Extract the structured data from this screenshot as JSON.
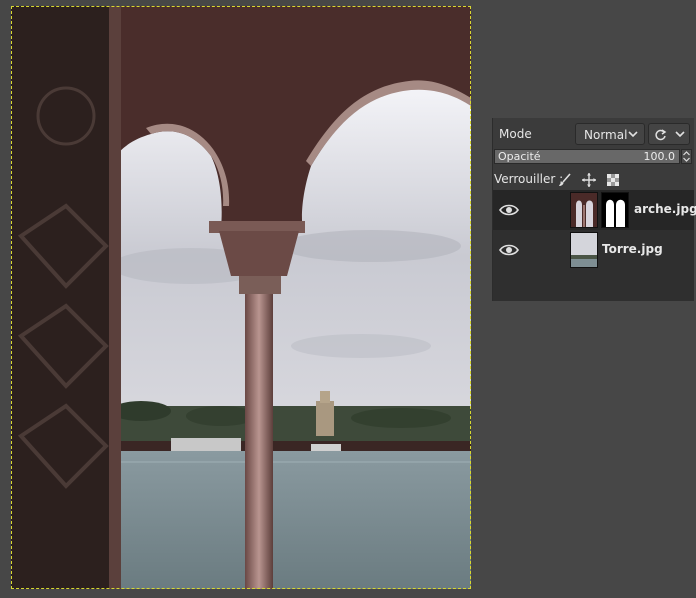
{
  "layers_panel": {
    "mode_label": "Mode",
    "mode_value": "Normal",
    "opacity_label": "Opacité",
    "opacity_value": "100.0",
    "opacity_fraction": 1.0,
    "lock_label": "Verrouiller :",
    "lock_icons": [
      "paintbrush-icon",
      "move-icon",
      "alpha-checker-icon"
    ],
    "layers": [
      {
        "name": "arche.jpg",
        "visible": true,
        "has_mask": true
      },
      {
        "name": "Torre.jpg",
        "visible": true,
        "has_mask": false
      }
    ]
  },
  "colors": {
    "background": "#474747",
    "panel": "#3b3b3b",
    "selection_border": "#d8d830"
  }
}
